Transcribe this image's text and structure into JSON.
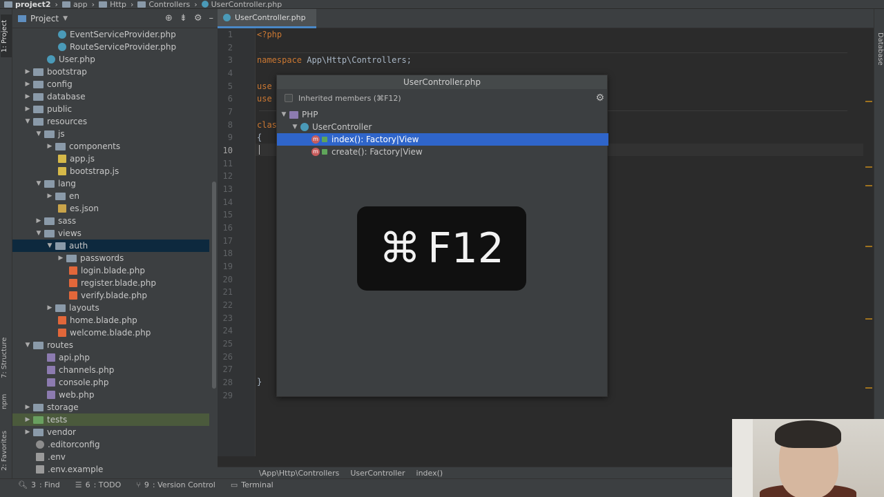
{
  "breadcrumbs": [
    "project2",
    "app",
    "Http",
    "Controllers",
    "UserController.php"
  ],
  "left_strip": {
    "project_tab": "1: Project",
    "structure_tab": "7: Structure",
    "npm_tab": "npm",
    "favorites_tab": "2: Favorites"
  },
  "right_strip": {
    "database_tab": "Database"
  },
  "project_panel": {
    "title": "Project",
    "tree": [
      {
        "label": "EventServiceProvider.php"
      },
      {
        "label": "RouteServiceProvider.php"
      },
      {
        "label": "User.php"
      },
      {
        "label": "bootstrap"
      },
      {
        "label": "config"
      },
      {
        "label": "database"
      },
      {
        "label": "public"
      },
      {
        "label": "resources"
      },
      {
        "label": "js"
      },
      {
        "label": "components"
      },
      {
        "label": "app.js"
      },
      {
        "label": "bootstrap.js"
      },
      {
        "label": "lang"
      },
      {
        "label": "en"
      },
      {
        "label": "es.json"
      },
      {
        "label": "sass"
      },
      {
        "label": "views"
      },
      {
        "label": "auth"
      },
      {
        "label": "passwords"
      },
      {
        "label": "login.blade.php"
      },
      {
        "label": "register.blade.php"
      },
      {
        "label": "verify.blade.php"
      },
      {
        "label": "layouts"
      },
      {
        "label": "home.blade.php"
      },
      {
        "label": "welcome.blade.php"
      },
      {
        "label": "routes"
      },
      {
        "label": "api.php"
      },
      {
        "label": "channels.php"
      },
      {
        "label": "console.php"
      },
      {
        "label": "web.php"
      },
      {
        "label": "storage"
      },
      {
        "label": "tests"
      },
      {
        "label": "vendor"
      },
      {
        "label": ".editorconfig"
      },
      {
        "label": ".env"
      },
      {
        "label": ".env.example"
      }
    ]
  },
  "editor": {
    "tab_label": "UserController.php",
    "line_numbers": [
      "1",
      "2",
      "3",
      "4",
      "5",
      "6",
      "7",
      "8",
      "9",
      "10",
      "11",
      "12",
      "13",
      "14",
      "15",
      "16",
      "17",
      "18",
      "19",
      "20",
      "21",
      "22",
      "23",
      "24",
      "25",
      "26",
      "27",
      "28",
      "29"
    ],
    "code": {
      "l1": "<?php",
      "l3_kw": "namespace",
      "l3_rest": " App\\Http\\Controllers;",
      "l5": "use",
      "l6": "use",
      "l8": "clas",
      "l9": "{",
      "l28": "}"
    },
    "breadcrumbs": [
      "\\App\\Http\\Controllers",
      "UserController",
      "index()"
    ]
  },
  "popup": {
    "title": "UserController.php",
    "inherited_label": "Inherited members (⌘F12)",
    "nodes": {
      "php": "PHP",
      "class": "UserController",
      "method1": "index(): Factory|View",
      "method2": "create(): Factory|View"
    },
    "method_badge": "m"
  },
  "shortcut_overlay": {
    "symbol": "⌘",
    "key": "F12"
  },
  "bottom_tools": [
    {
      "num": "3",
      "label": ": Find"
    },
    {
      "num": "6",
      "label": ": TODO"
    },
    {
      "num": "9",
      "label": ": Version Control"
    },
    {
      "num": "",
      "label": "Terminal"
    }
  ],
  "colors": {
    "selection": "#2f65ca",
    "accent_tab": "#4a88c7",
    "keyword": "#cc7832"
  }
}
